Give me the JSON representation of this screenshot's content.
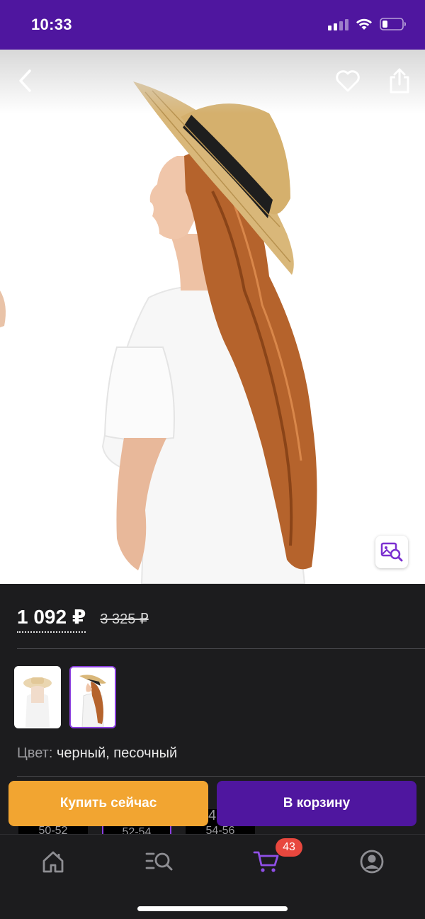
{
  "status_bar": {
    "time": "10:33"
  },
  "product": {
    "price": "1 092 ₽",
    "old_price": "3 325 ₽",
    "color_label": "Цвет:",
    "color_value": "черный, песочный",
    "thumbnails": [
      "thumbnail-front",
      "thumbnail-side"
    ],
    "sizes": [
      "50-52",
      "52-54",
      "54-56"
    ],
    "size_partial_digit": "4"
  },
  "actions": {
    "buy_now": "Купить сейчас",
    "add_to_cart": "В корзину"
  },
  "nav": {
    "cart_count": "43",
    "items": [
      "home-icon",
      "catalog-search-icon",
      "cart-icon",
      "profile-icon"
    ]
  },
  "colors": {
    "brand_purple": "#4f169f",
    "accent_orange": "#f2a531",
    "badge_red": "#e8473e",
    "background": "#1c1c1e"
  }
}
